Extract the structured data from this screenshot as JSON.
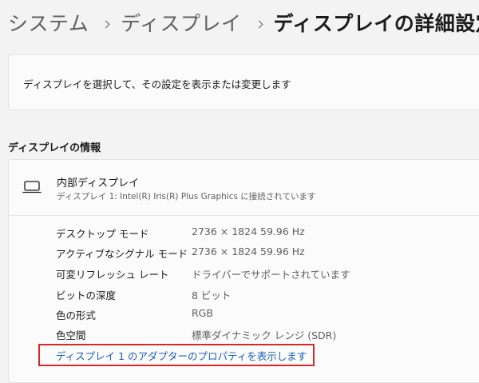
{
  "breadcrumb": {
    "items": [
      "システム",
      "ディスプレイ",
      "ディスプレイの詳細設定"
    ]
  },
  "select_card": {
    "text": "ディスプレイを選択して、その設定を表示または変更します"
  },
  "info_section": {
    "heading": "ディスプレイの情報",
    "display_name": "内部ディスプレイ",
    "display_subtitle": "ディスプレイ 1: Intel(R) Iris(R) Plus Graphics に接続されています",
    "display_icon": "laptop-icon",
    "specs": [
      {
        "label": "デスクトップ モード",
        "value": "2736 × 1824 59.96 Hz"
      },
      {
        "label": "アクティブなシグナル モード",
        "value": "2736 × 1824 59.96 Hz"
      },
      {
        "label": "可変リフレッシュ レート",
        "value": "ドライバーでサポートされています"
      },
      {
        "label": "ビットの深度",
        "value": "8 ビット"
      },
      {
        "label": "色の形式",
        "value": "RGB"
      },
      {
        "label": "色空間",
        "value": "標準ダイナミック レンジ (SDR)"
      }
    ],
    "adapter_link": "ディスプレイ 1 のアダプターのプロパティを表示します"
  },
  "colors": {
    "background": "#f3f3f3",
    "card": "#fbfbfb",
    "link": "#1a5fb4",
    "highlight": "#d42a2a"
  }
}
